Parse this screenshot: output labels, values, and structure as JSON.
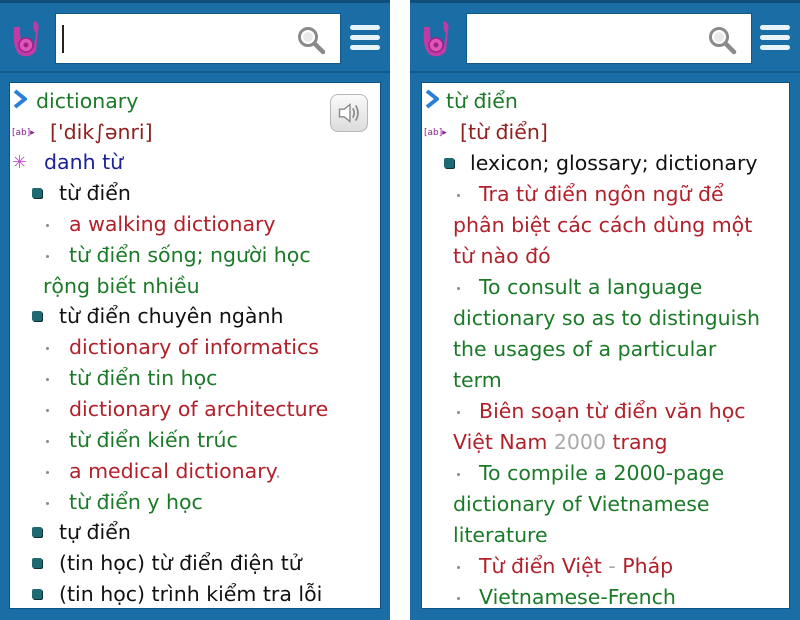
{
  "app": {
    "colors": {
      "header_bg": "#1a6ea5",
      "headword": "#1b7a28",
      "phonetic": "#8e2220",
      "pos": "#1a1f9a",
      "example": "#b2202a",
      "translation": "#1b7a28",
      "meaning": "#111111"
    },
    "icons": {
      "logo": "music-note-logo",
      "search": "magnifier-icon",
      "menu": "hamburger-icon",
      "headword": "chevron-right-icon",
      "phonetic": "ab-pronunciation-icon",
      "pos": "asterisk-icon",
      "meaning": "square-bullet-icon",
      "example": "dot-bullet-icon",
      "sound": "speaker-icon"
    }
  },
  "left": {
    "search": {
      "value": "",
      "placeholder": ""
    },
    "entry": {
      "headword": "dictionary",
      "phonetic": "['dik∫ənri]",
      "pos": "danh từ",
      "lines": [
        {
          "kind": "meaning",
          "text": "từ điển"
        },
        {
          "kind": "example",
          "text": "a walking dictionary"
        },
        {
          "kind": "translation",
          "text": "từ điển sống; người học"
        },
        {
          "kind": "translation-cont",
          "text": "rộng biết nhiều"
        },
        {
          "kind": "meaning",
          "text": "từ điển chuyên ngành"
        },
        {
          "kind": "example",
          "text": "dictionary of informatics"
        },
        {
          "kind": "translation",
          "text": "từ điển tin học"
        },
        {
          "kind": "example",
          "text": "dictionary of architecture"
        },
        {
          "kind": "translation",
          "text": "từ điển kiến trúc"
        },
        {
          "kind": "example",
          "text": "a medical dictionary"
        },
        {
          "kind": "translation",
          "text": "từ điển y học"
        },
        {
          "kind": "meaning",
          "text": "tự điển"
        },
        {
          "kind": "meaning",
          "text": "(tin học) từ điển điện tử"
        },
        {
          "kind": "meaning",
          "text": "(tin học) trình kiểm tra lỗi"
        }
      ],
      "example_suffix_10": "."
    }
  },
  "right": {
    "search": {
      "value": "",
      "placeholder": ""
    },
    "entry": {
      "headword": "từ điển",
      "phonetic": "[từ điển]",
      "lines": [
        {
          "kind": "meaning",
          "text": "lexicon; glossary; dictionary"
        },
        {
          "kind": "example",
          "text": "Tra từ điển ngôn ngữ để"
        },
        {
          "kind": "example-cont",
          "text": "phân biệt các cách dùng một"
        },
        {
          "kind": "example-cont",
          "text": "từ nào đó"
        },
        {
          "kind": "translation",
          "text": "To consult a language"
        },
        {
          "kind": "translation-cont",
          "text": "dictionary so as to distinguish"
        },
        {
          "kind": "translation-cont",
          "text": "the usages of a particular"
        },
        {
          "kind": "translation-cont",
          "text": "term"
        },
        {
          "kind": "example",
          "text": "Biên soạn từ điển văn học"
        },
        {
          "kind": "example-cont-mixed",
          "parts": [
            "Việt Nam ",
            "2000",
            " trang"
          ]
        },
        {
          "kind": "translation",
          "text": "To compile a 2000-page"
        },
        {
          "kind": "translation-cont",
          "text": "dictionary of Vietnamese"
        },
        {
          "kind": "translation-cont",
          "text": "literature"
        },
        {
          "kind": "example-mixed",
          "parts": [
            "Từ điển Việt ",
            "-",
            " Pháp"
          ]
        },
        {
          "kind": "translation",
          "text": "Vietnamese-French"
        }
      ]
    }
  }
}
